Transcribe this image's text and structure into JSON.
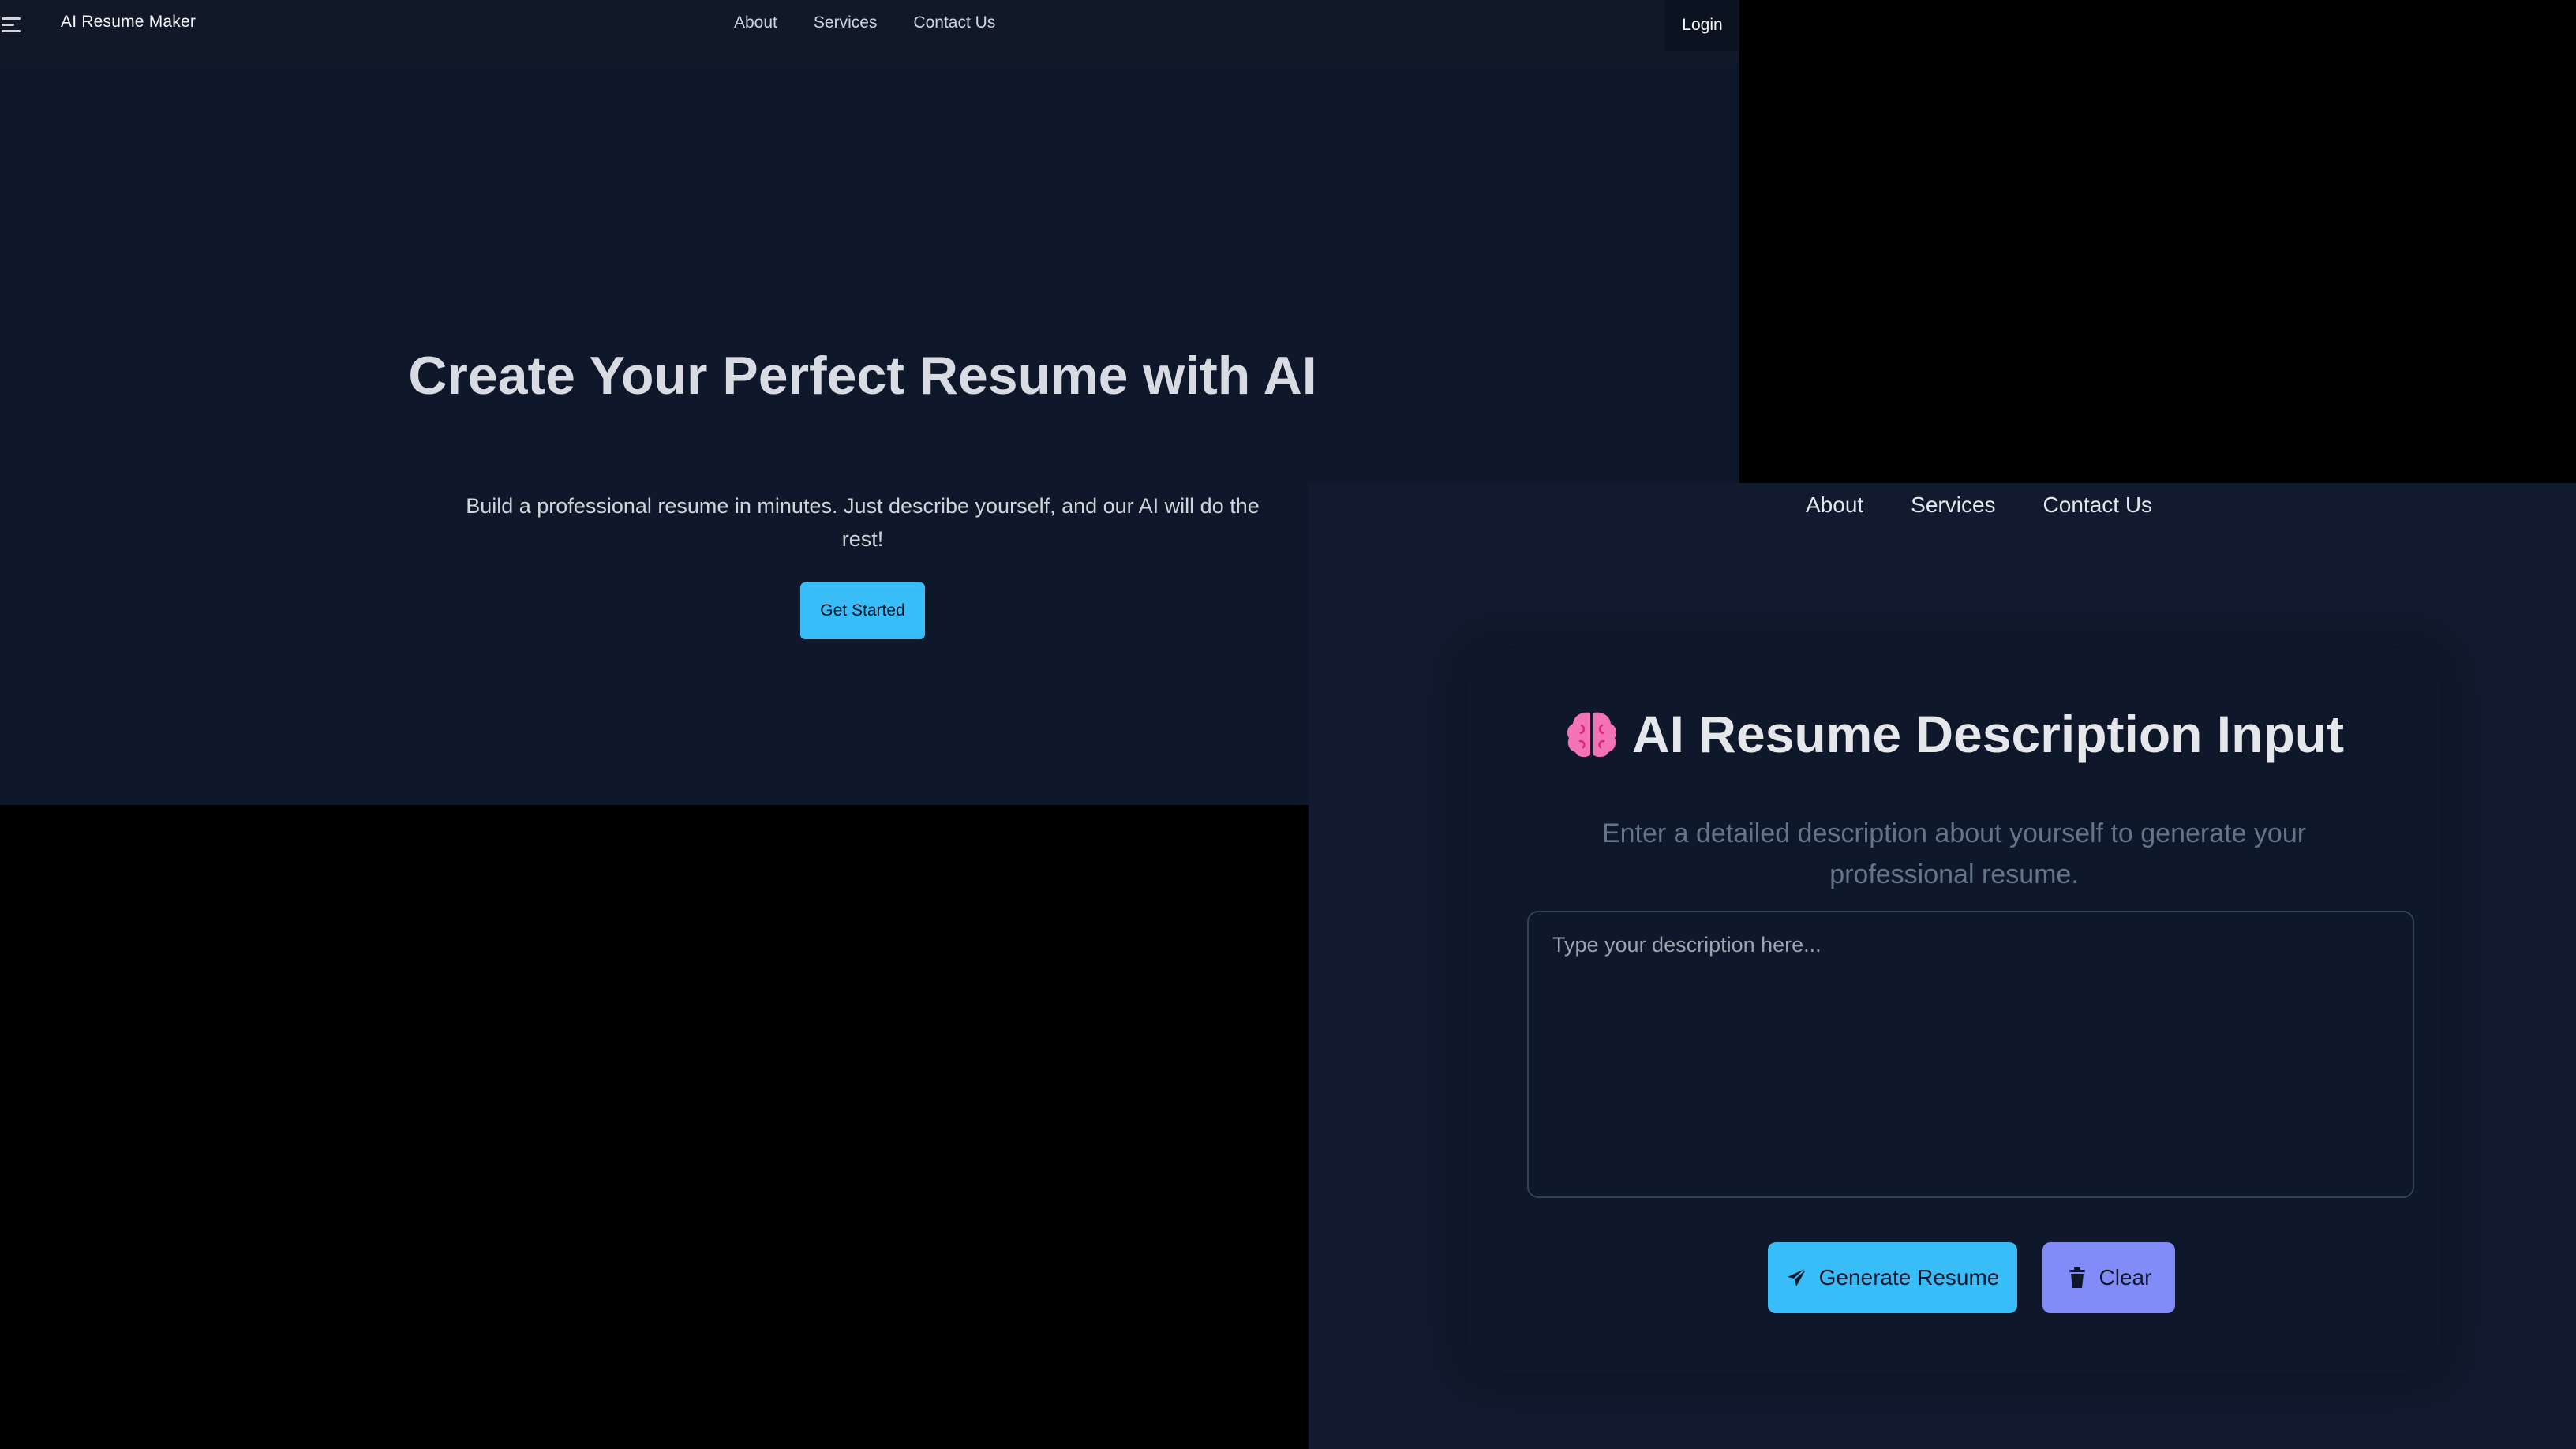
{
  "landing": {
    "brand": "AI Resume Maker",
    "nav": [
      "About",
      "Services",
      "Contact Us"
    ],
    "login_label": "Login",
    "hero_title": "Create Your Perfect Resume with AI",
    "hero_subtitle": "Build a professional resume in minutes. Just describe yourself, and our AI will do the rest!",
    "cta_label": "Get Started",
    "icons": {
      "menu": "hamburger-menu-icon"
    },
    "colors": {
      "background": "#0f172a",
      "accent": "#38bdf8"
    }
  },
  "description_page": {
    "nav": [
      "About",
      "Services",
      "Contact Us"
    ],
    "title": "AI Resume Description Input",
    "subtitle": "Enter a detailed description about yourself to generate your professional resume.",
    "textarea": {
      "placeholder": "Type your description here...",
      "value": ""
    },
    "generate_label": "Generate Resume",
    "clear_label": "Clear",
    "icons": {
      "title": "brain-icon",
      "generate": "paper-plane-icon",
      "clear": "trash-icon"
    },
    "colors": {
      "primary": "#38bdf8",
      "secondary": "#818cf8",
      "brain": "#f472b6"
    }
  }
}
